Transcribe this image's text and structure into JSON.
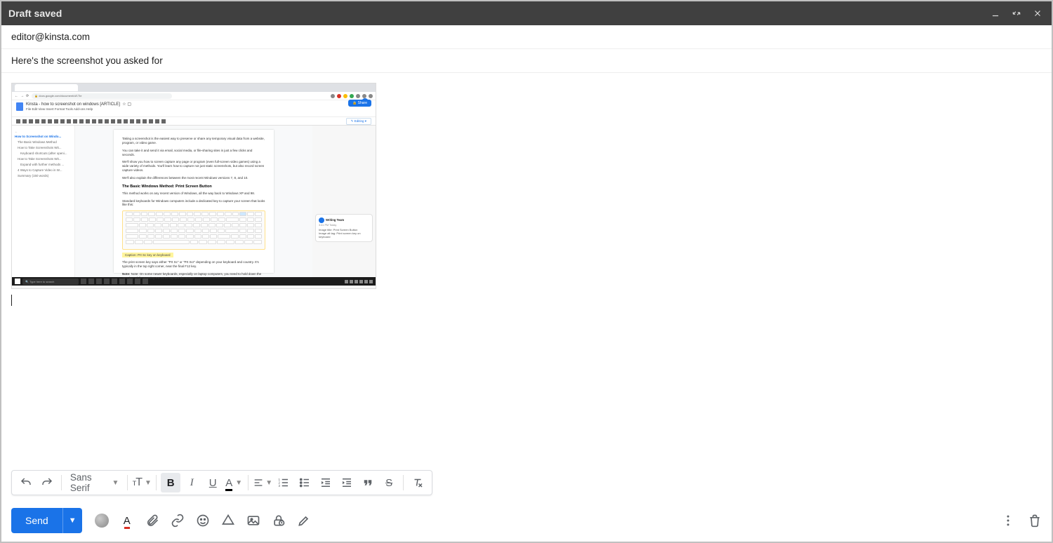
{
  "window": {
    "title": "Draft saved"
  },
  "to": "editor@kinsta.com",
  "subject": "Here's the screenshot you asked for",
  "font_family": "Sans Serif",
  "send_label": "Send",
  "screenshot": {
    "url": "docs.google.com/document/d/1Tle",
    "doc_title": "Kinsta - how to screenshot on windows [ARTICLE]",
    "menu": "File  Edit  View  Insert  Format  Tools  Add-ons  Help",
    "share": "Share",
    "outline": {
      "h1": "How to Screenshot on Windo...",
      "items": [
        "The Basic Windows Method",
        "How to Take Screenshots Wit...",
        "Keyboard shortcuts (after openi...",
        "How to Take Screenshots Wit...",
        "Expand with further methods ...",
        "4 Ways to Capture Video in W...",
        "Summary (150 words)"
      ]
    },
    "paragraphs": {
      "p1": "Taking a screenshot is the easiest way to preserve or share any temporary visual data from a website, program, or video game.",
      "p2": "You can take it and send it via email, social media, or file-sharing sites in just a few clicks and seconds.",
      "p3": "We'll show you how to screen capture any page or program (even full-screen video games) using a wide variety of methods. You'll learn how to capture not just static screenshots, but also record screen capture videos.",
      "p4": "We'll also explain the differences between the most recent Windows versions 7, 8, and 10.",
      "h": "The Basic Windows Method: Print Screen Button",
      "p5": "This method works on any recent version of Windows, all the way back to Windows XP and 98.",
      "p6": "Standard keyboards for Windows computers include a dedicated key to capture your screen that looks like this:",
      "caption": "Caption: Prt Sc key on keyboard",
      "p7": "The print screen key says either \"Prt Sc\" or \"Prt Scr\" depending on your keyboard and country. It's typically in the top right corner, near the final F12 key.",
      "p8": "Note: On some newer keyboards, especially on laptop computers, you need to hold down the \"Fn\" key while pressing Prt Sc to capture the screen."
    },
    "comment": {
      "author": "Writing Team",
      "time": "3:41 PM Today",
      "text": "Image title: Print Screen Button\nImage alt tag: Print screen key on keyboard"
    },
    "taskbar_search": "Type here to search"
  }
}
